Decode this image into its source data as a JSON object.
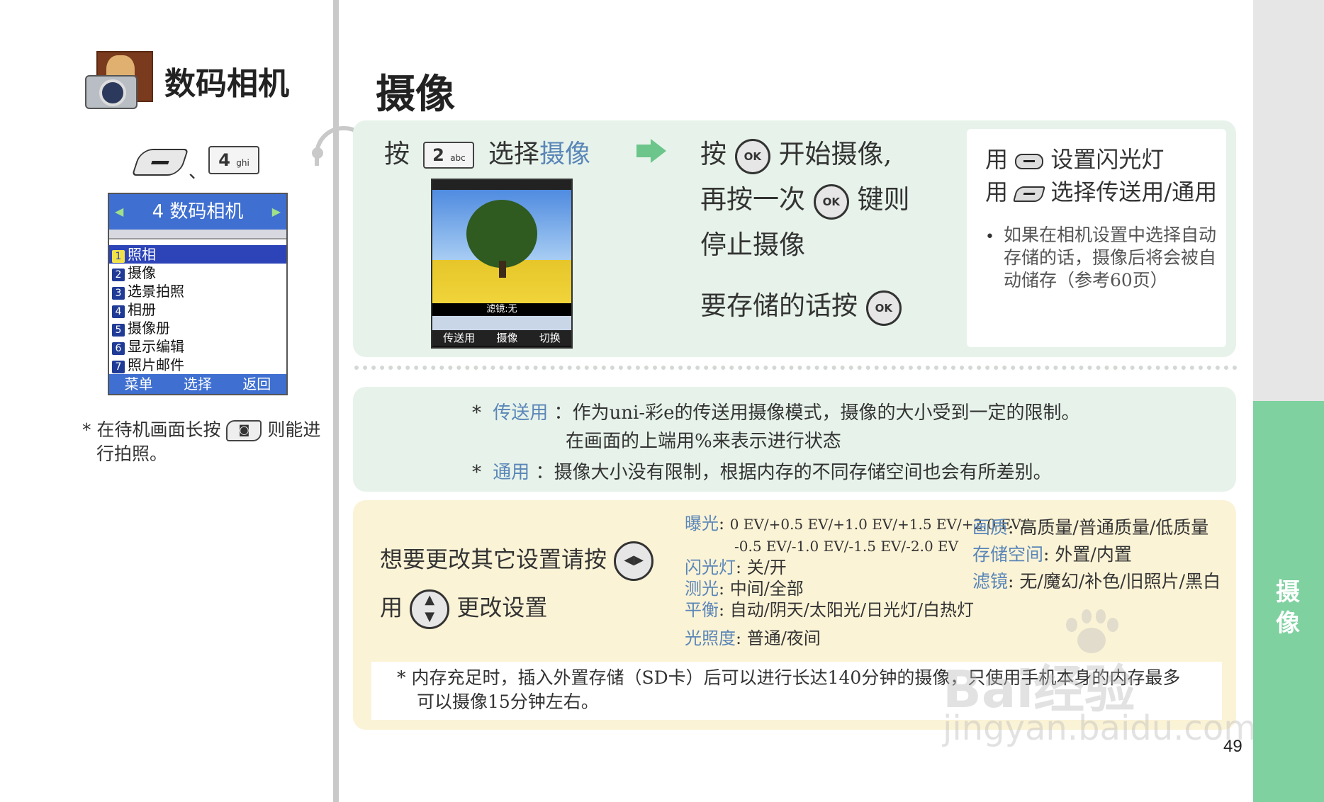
{
  "sidebar": {
    "section_title": "数码相机",
    "key_separator": "、",
    "key4": {
      "digit": "4",
      "letters": "ghi"
    },
    "phone_screen": {
      "title": "4 数码相机",
      "menu_items": [
        {
          "num": "1",
          "label": "照相"
        },
        {
          "num": "2",
          "label": "摄像"
        },
        {
          "num": "3",
          "label": "选景拍照"
        },
        {
          "num": "4",
          "label": "相册"
        },
        {
          "num": "5",
          "label": "摄像册"
        },
        {
          "num": "6",
          "label": "显示编辑"
        },
        {
          "num": "7",
          "label": "照片邮件"
        }
      ],
      "softkeys": [
        "菜单",
        "选择",
        "返回"
      ]
    },
    "note_part1": "在待机画面长按",
    "note_part2": "则能进",
    "note_part3": "行拍照。"
  },
  "main": {
    "title": "摄像",
    "step1": {
      "press": "按",
      "key2": {
        "digit": "2",
        "letters": "abc"
      },
      "select_text": "选择",
      "select_target": "摄像"
    },
    "camera_screen": {
      "filter_label": "滤镜:无",
      "softkeys": [
        "传送用",
        "摄像",
        "切换"
      ]
    },
    "step2": {
      "line1a": "按",
      "line1b": "开始摄像,",
      "line2a": "再按一次",
      "line2b": "键则",
      "line3": "停止摄像",
      "line4": "要存储的话按",
      "ok_label": "OK"
    },
    "tips": {
      "line1a": "用",
      "line1b": "设置闪光灯",
      "line2a": "用",
      "line2b": "选择传送用/通用",
      "bullet": "如果在相机设置中选择自动存储的话，摄像后将会被自动储存（参考60页）"
    },
    "modes": [
      {
        "name": "传送用",
        "line1": "作为uni-彩e的传送用摄像模式，摄像的大小受到一定的限制。",
        "line2": "在画面的上端用%来表示进行状态"
      },
      {
        "name": "通用",
        "line1": "摄像大小没有限制，根据内存的不同存储空间也会有所差别。"
      }
    ],
    "settings": {
      "intro1": "想要更改其它设置请按",
      "intro2a": "用",
      "intro2b": "更改设置",
      "col1": [
        {
          "label": "曝光",
          "value": "0 EV/+0.5 EV/+1.0 EV/+1.5 EV/+2.0 EV/"
        },
        {
          "label": "",
          "value": "-0.5 EV/-1.0 EV/-1.5 EV/-2.0 EV"
        },
        {
          "label": "闪光灯",
          "value": "关/开"
        },
        {
          "label": "测光",
          "value": "中间/全部"
        },
        {
          "label": "平衡",
          "value": "自动/阴天/太阳光/日光灯/白热灯"
        },
        {
          "label": "光照度",
          "value": "普通/夜间"
        }
      ],
      "col2": [
        {
          "label": "画质",
          "value": "高质量/普通质量/低质量"
        },
        {
          "label": "存储空间",
          "value": "外置/内置"
        },
        {
          "label": "滤镜",
          "value": "无/魔幻/补色/旧照片/黑白"
        }
      ],
      "note_line1": "内存充足时，插入外置存储（SD卡）后可以进行长达140分钟的摄像，只使用手机本身的内存最多",
      "note_line2": "可以摄像15分钟左右。"
    },
    "page_number": "49"
  },
  "side_tab": {
    "char1": "摄",
    "char2": "像"
  },
  "watermark": {
    "brand": "Bai经验",
    "url": "jingyan.baidu.com"
  },
  "colors": {
    "green_panel": "#e7f3ea",
    "yellow_panel": "#fbf3d6",
    "tab_green": "#7fd1a0",
    "accent_blue": "#5a86b8"
  }
}
